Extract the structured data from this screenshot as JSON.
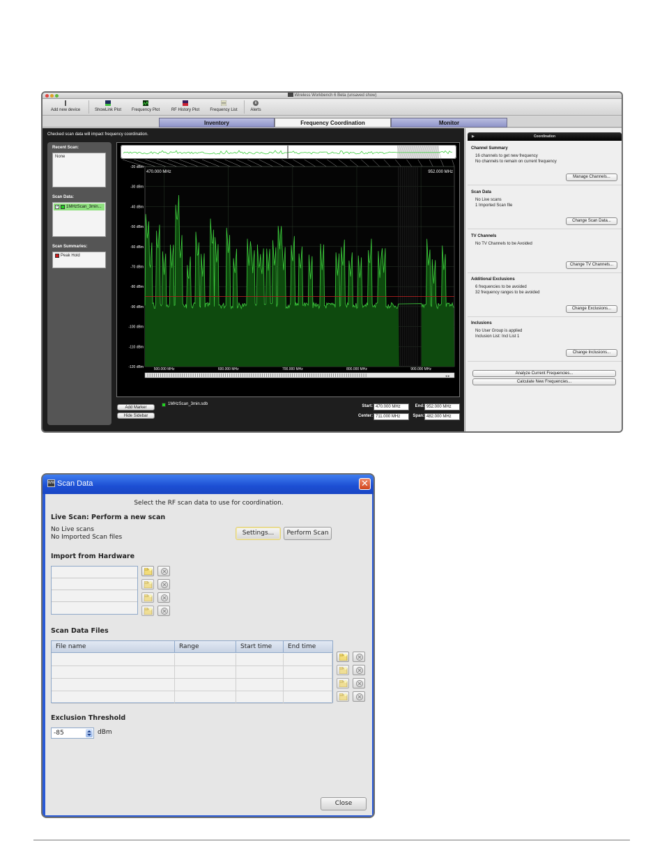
{
  "app": {
    "title": "Wireless Workbench 6 Beta (unsaved show)",
    "toolbar": [
      "Add new device",
      "ShowLink Plot",
      "Frequency Plot",
      "RF History Plot",
      "Frequency List",
      "Alerts"
    ],
    "tabs": [
      "Inventory",
      "Frequency Coordination",
      "Monitor"
    ],
    "active_tab": "Frequency Coordination",
    "notice": "Checked scan data will impact frequency coordination.",
    "sidebar": {
      "recent_label": "Recent Scan:",
      "recent_value": "None",
      "scan_data_label": "Scan Data:",
      "scan_item": "1MHzScan_3min...",
      "summaries_label": "Scan Summaries:",
      "summary_item": "Peak Hold"
    },
    "plot": {
      "left_freq": "470.000 MHz",
      "right_freq": "952.000 MHz",
      "y_ticks": [
        "-20 dBm",
        "-30 dBm",
        "-40 dBm",
        "-50 dBm",
        "-60 dBm",
        "-70 dBm",
        "-80 dBm",
        "-90 dBm",
        "-100 dBm",
        "-110 dBm",
        "-120 dBm"
      ],
      "x_ticks": [
        "500.000 MHz",
        "600.000 MHz",
        "700.000 MHz",
        "800.000 MHz",
        "900.000 MHz"
      ]
    },
    "bottom": {
      "add_marker": "Add Marker",
      "hide_sidebar": "Hide Sidebar",
      "legend_file": "1MHzScan_3min.sdb",
      "start_label": "Start:",
      "start_value": "470.000 MHz",
      "end_label": "End:",
      "end_value": "952.000 MHz",
      "center_label": "Center:",
      "center_value": "711.000 MHz",
      "span_label": "Span:",
      "span_value": "482.000 MHz"
    },
    "coordination": {
      "header": "Coordination",
      "channel_summary": {
        "title": "Channel Summary",
        "lines": [
          "16 channels to get new frequency",
          "No channels to remain on current frequency"
        ],
        "button": "Manage Channels..."
      },
      "scan_data": {
        "title": "Scan Data",
        "lines": [
          "No Live scans",
          "1 Imported Scan file"
        ],
        "button": "Change Scan Data..."
      },
      "tv_channels": {
        "title": "TV Channels",
        "lines": [
          "No TV Channels to be Avoided"
        ],
        "button": "Change TV Channels..."
      },
      "exclusions": {
        "title": "Additional Exclusions",
        "lines": [
          "6 frequencies to be avoided",
          "32 frequency ranges to be avoided"
        ],
        "button": "Change Exclusions..."
      },
      "inclusions": {
        "title": "Inclusions",
        "lines": [
          "No User Group is applied",
          "Inclusion List: Incl List 1"
        ],
        "button": "Change Inclusions..."
      },
      "analyze": "Analyze Current Frequencies...",
      "calculate": "Calculate New Frequencies..."
    },
    "colors": {
      "trace": "#3ecf3e",
      "fill": "#0e4a0e",
      "threshold": "#b02020",
      "tab_inactive": "#9aa0d2"
    }
  },
  "dialog": {
    "title": "Scan Data",
    "intro": "Select the RF scan data to use for coordination.",
    "live_heading": "Live Scan: Perform a new scan",
    "live_lines": [
      "No Live scans",
      "No Imported Scan files"
    ],
    "settings_btn": "Settings...",
    "perform_btn": "Perform Scan",
    "import_heading": "Import from Hardware",
    "files_heading": "Scan Data Files",
    "columns": [
      "File name",
      "Range",
      "Start time",
      "End time"
    ],
    "threshold_heading": "Exclusion Threshold",
    "threshold_value": "-85",
    "threshold_unit": "dBm",
    "close_btn": "Close"
  }
}
